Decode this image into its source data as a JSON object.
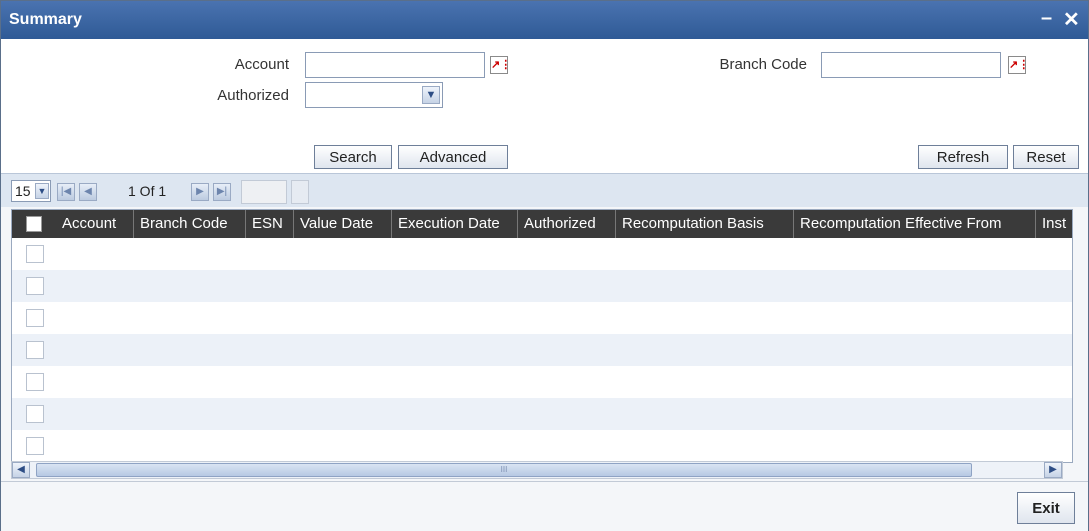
{
  "window": {
    "title": "Summary",
    "minimize": "–",
    "close": "✕"
  },
  "form": {
    "account_label": "Account",
    "branch_code_label": "Branch Code",
    "authorized_label": "Authorized",
    "lov_glyph": "↗⋮"
  },
  "buttons": {
    "search": "Search",
    "advanced": "Advanced",
    "refresh": "Refresh",
    "reset": "Reset",
    "exit": "Exit"
  },
  "pager": {
    "page_size": "15",
    "page_text": "1 Of 1",
    "first": "|◀",
    "prev": "◀",
    "next": "▶",
    "last": "▶|"
  },
  "grid": {
    "columns": [
      "Account",
      "Branch Code",
      "ESN",
      "Value Date",
      "Execution Date",
      "Authorized",
      "Recomputation Basis",
      "Recomputation Effective From",
      "Inst"
    ],
    "row_count": 7
  },
  "scroll": {
    "up": "▲",
    "down": "▼",
    "left": "◀",
    "right": "▶",
    "grip": "III"
  },
  "colors": {
    "titlebar": "#3b64a2",
    "header": "#3a3a3a",
    "row_alt": "#ecf1f8"
  }
}
